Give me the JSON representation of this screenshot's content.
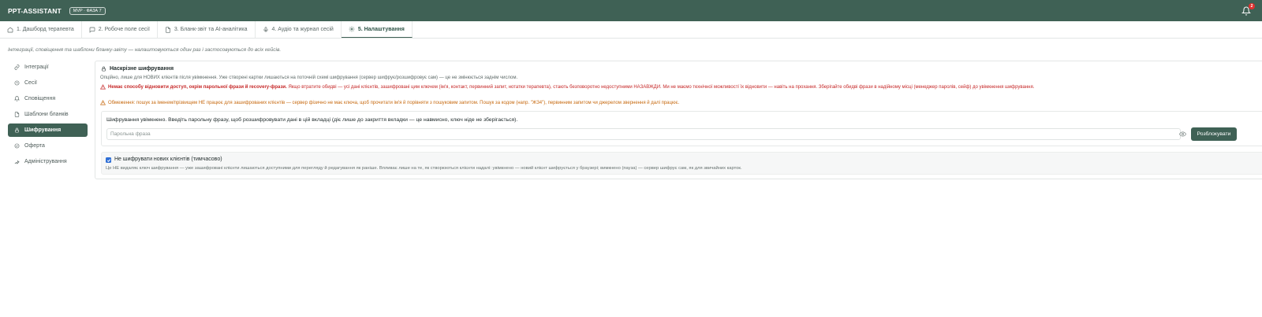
{
  "topbar": {
    "brand": "PPT-ASSISTANT",
    "phase_badge": "MVP · ФАЗА 7",
    "notifications_count": "2"
  },
  "tabs": [
    {
      "label": "1. Дашборд терапевта",
      "icon": "home-icon",
      "active": false
    },
    {
      "label": "2. Робоче поле сесії",
      "icon": "chat-icon",
      "active": false
    },
    {
      "label": "3. Бланк-звіт та AI-аналітика",
      "icon": "document-icon",
      "active": false
    },
    {
      "label": "4. Аудіо та журнал сесій",
      "icon": "microphone-icon",
      "active": false
    },
    {
      "label": "5. Налаштування",
      "icon": "gear-icon",
      "active": true
    }
  ],
  "intro": "Інтеграції, сповіщення та шаблони бланку-звіту — налаштовуються один раз і застосовуються до всіх кейсів.",
  "sidebar": {
    "items": [
      {
        "label": "Інтеграції",
        "icon": "link-icon",
        "active": false
      },
      {
        "label": "Сесії",
        "icon": "clock-icon",
        "active": false
      },
      {
        "label": "Сповіщення",
        "icon": "bell-icon",
        "active": false
      },
      {
        "label": "Шаблони бланків",
        "icon": "document-icon",
        "active": false
      },
      {
        "label": "Шифрування",
        "icon": "lock-icon",
        "active": true
      },
      {
        "label": "Оферта",
        "icon": "check-circle-icon",
        "active": false
      },
      {
        "label": "Адміністрування",
        "icon": "wrench-icon",
        "active": false
      }
    ]
  },
  "encryption": {
    "title": "Наскрізне шифрування",
    "description": "Опційно, лише для НОВИХ клієнтів після увімкнення. Уже створені картки лишаються на поточній схемі шифрування (сервер шифрує/розшифровує сам) — це не змінюється заднім числом.",
    "warning_bold": "Немає способу відновити доступ, окрім парольної фрази й recovery-фрази.",
    "warning_rest": "Якщо втратите обидві — усі дані клієнтів, зашифровані цим ключем (ім'я, контакт, первинний запит, нотатки терапевта), стають безповоротно недоступними НАЗАВЖДИ. Ми не маємо технічної можливості їх відновити — навіть на прохання. Зберігайте обидві фрази в надійному місці (менеджер паролів, сейф) до увімкнення шифрування.",
    "limitation": "Обмеження: пошук за іменем/прізвищем НЕ працює для зашифрованих клієнтів — сервер фізично не має ключа, щоб прочитати ім'я й порівняти з пошуковим запитом. Пошук за кодом (напр. \"Ж34\"), первинним запитом чи джерелом звернення й далі працює.",
    "unlock_text": "Шифрування увімкнено. Введіть парольну фразу, щоб розшифровувати дані в цій вкладці (діє лише до закриття вкладки — це навмисно, ключ ніде не зберігається).",
    "passphrase_placeholder": "Парольна фраза",
    "unlock_button": "Розблокувати",
    "toggle_label": "Не шифрувати нових клієнтів (тимчасово)",
    "toggle_checked": true,
    "toggle_help": "Це НЕ видаляє ключ шифрування — уже зашифровані клієнти лишаються доступними для перегляду й редагування як раніше. Впливає лише на те, як створюються клієнти надалі: увімкнено — новий клієнт шифрується у браузері; вимкнено (пауза) — сервер шифрує сам, як для звичайних карток."
  },
  "colors": {
    "primary": "#3f6155",
    "warning_red": "#c62828",
    "warning_orange": "#c76a10",
    "checkbox": "#2f6fd6"
  }
}
